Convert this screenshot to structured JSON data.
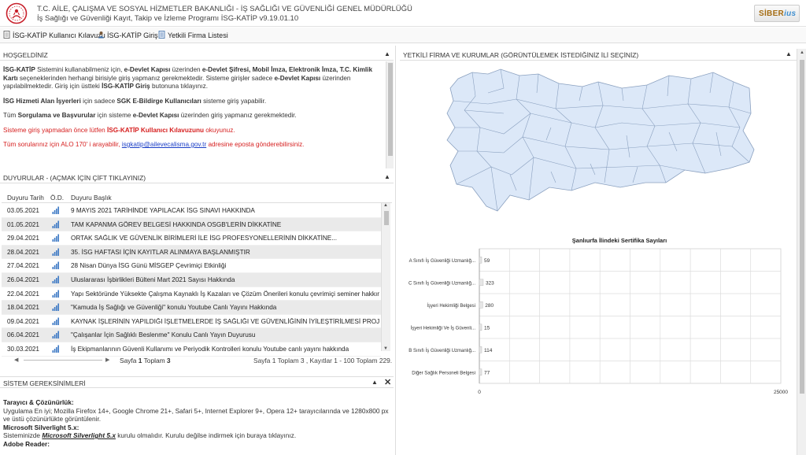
{
  "header": {
    "org_line": "T.C. AİLE, ÇALIŞMA VE SOSYAL HİZMETLER BAKANLIĞI - İŞ SAĞLIĞI VE GÜVENLİĞİ GENEL MÜDÜRLÜĞÜ",
    "program_line": "İş Sağlığı ve Güvenliği Kayıt, Takip ve İzleme Programı İSG-KATİP v9.19.01.10",
    "brand_logo": "SİBER",
    "logo_icon": "ministry-emblem-icon"
  },
  "toolbar": {
    "items": [
      {
        "label": "İSG-KATİP Kullanıcı Kılavuzu",
        "icon": "document-icon"
      },
      {
        "label": "İSG-KATİP Giriş",
        "icon": "user-login-icon"
      },
      {
        "label": "Yetkili Firma Listesi",
        "icon": "list-icon"
      }
    ]
  },
  "welcome": {
    "title": "HOŞGELDİNİZ",
    "p1_a": "İSG-KATİP",
    "p1_b": " Sistemini kullanabilmeniz için, ",
    "p1_c": "e-Devlet Kapısı",
    "p1_d": " üzerinden ",
    "p1_e": "e-Devlet Şifresi, Mobil İmza, Elektronik İmza, T.C. Kimlik Kartı",
    "p1_f": " seçeneklerinden herhangi birisiyle giriş yapmanız gerekmektedir. Sisteme girişler sadece ",
    "p1_g": "e-Devlet Kapısı",
    "p1_h": " üzerinden yapılabilmektedir. Giriş için üstteki ",
    "p1_i": "İSG-KATİP Giriş",
    "p1_j": " butonuna tıklayınız.",
    "p2_a": "İSG Hizmeti Alan İşyerleri",
    "p2_b": " için sadece ",
    "p2_c": "SGK E-Bildirge Kullanıcıları",
    "p2_d": " sisteme giriş yapabilir.",
    "p3_a": "Tüm ",
    "p3_b": "Sorgulama ve Başvurular",
    "p3_c": " için sisteme ",
    "p3_d": "e-Devlet Kapısı",
    "p3_e": " üzerinden giriş yapmanız gerekmektedir.",
    "p4_a": "Sisteme giriş yapmadan önce lütfen ",
    "p4_b": "İSG-KATİP Kullanıcı Kılavuzunu",
    "p4_c": " okuyunuz.",
    "p5_a": "Tüm sorularınız için ALO 170' i arayabilir, ",
    "p5_b": "isgkatip@ailevecalisma.gov.tr",
    "p5_c": " adresine eposta gönderebilirsiniz."
  },
  "announcements": {
    "title": "DUYURULAR - (AÇMAK İÇİN ÇİFT TIKLAYINIZ)",
    "col_date": "Duyuru Tarih",
    "col_od": "Ö.D.",
    "col_title": "Duyuru Başlık",
    "rows": [
      {
        "date": "03.05.2021",
        "title": "9 MAYIS 2021 TARİHİNDE YAPILACAK İSG SINAVI HAKKINDA"
      },
      {
        "date": "01.05.2021",
        "title": "TAM KAPANMA GÖREV BELGESİ HAKKINDA OSGB'LERİN DİKKATİNE"
      },
      {
        "date": "29.04.2021",
        "title": "ORTAK SAĞLIK VE GÜVENLİK BİRİMLERİ İLE İSG PROFESYONELLERİNİN DİKKATİNE..."
      },
      {
        "date": "28.04.2021",
        "title": "35. İSG HAFTASI İÇİN KAYITLAR ALINMAYA BAŞLANMIŞTIR"
      },
      {
        "date": "27.04.2021",
        "title": "28 Nisan Dünya İSG Günü MİSGEP Çevrimiçi Etkinliği"
      },
      {
        "date": "26.04.2021",
        "title": "Uluslararası İşbirlikleri Bülteni Mart 2021 Sayısı Hakkında"
      },
      {
        "date": "22.04.2021",
        "title": "Yapı Sektöründe Yüksekte Çalışma Kaynaklı İş Kazaları ve Çözüm Önerileri konulu çevrimiçi seminer hakkında"
      },
      {
        "date": "18.04.2021",
        "title": "\"Kamuda İş Sağlığı ve Güvenliği\" konulu Youtube Canlı Yayını Hakkında"
      },
      {
        "date": "09.04.2021",
        "title": "KAYNAK İŞLERİNİN YAPILDIĞI İŞLETMELERDE İŞ SAĞLIĞI VE GÜVENLİĞİNİN İYİLEŞTİRİLMESİ PROJESİ İÇİN HİZM"
      },
      {
        "date": "06.04.2021",
        "title": "\"Çalışanlar İçin Sağlıklı Beslenme\" Konulu Canlı Yayın Duyurusu"
      },
      {
        "date": "30.03.2021",
        "title": "İş Ekipmanlarının Güvenli Kullanımı ve Periyodik Kontrolleri konulu Youtube canlı yayını hakkında"
      }
    ],
    "pager_left_a": "Sayfa ",
    "pager_page": "1",
    "pager_left_b": " Toplam ",
    "pager_total": "3",
    "pager_right": "Sayfa 1 Toplam 3 , Kayıtlar 1 - 100 Toplam 229."
  },
  "system": {
    "title": "SİSTEM GEREKSİNİMLERİ",
    "h1": "Tarayıcı & Çözünürlük:",
    "t1": "Uygulama En iyi; Mozilla Firefox 14+, Google Chrome 21+, Safari 5+, Internet Explorer 9+, Opera 12+ tarayıcılarında ve 1280x800 px ve üstü çözünürlükte görüntülenir.",
    "h2": "Microsoft Silverlight 5.x:",
    "t2_a": "Sisteminizde ",
    "t2_b": "Microsoft Silverlight 5.x",
    "t2_c": " kurulu olmalıdır. Kurulu değilse indirmek için buraya tıklayınız.",
    "h3": "Adobe Reader:"
  },
  "right_panel": {
    "title": "YETKİLİ FİRMA VE KURUMLAR (GÖRÜNTÜLEMEK İSTEDİĞİNİZ İLİ SEÇİNİZ)"
  },
  "chart_data": {
    "type": "bar",
    "orientation": "horizontal",
    "title": "Şanlıurfa İlindeki Sertifika Sayıları",
    "categories": [
      "A Sınıfı İş Güvenliği Uzmanlığ...",
      "C Sınıfı İş Güvenliği Uzmanlığ...",
      "İşyeri Hekimliği Belgesi",
      "İşyeri Hekimliği Ve İş Güvenli...",
      "B Sınıfı İş Güvenliği Uzmanlığ...",
      "Diğer Sağlık Personeli Belgesi"
    ],
    "values": [
      59,
      323,
      280,
      15,
      114,
      77
    ],
    "xlim": [
      0,
      25000
    ],
    "x_ticks": [
      "0",
      "25000"
    ],
    "grid": true,
    "bar_color": "#e6e6e6"
  },
  "colors": {
    "map_fill": "#dce8f8",
    "map_stroke": "#8aa0bf",
    "accent_red": "#d62020",
    "link_blue": "#1a3ec6"
  }
}
